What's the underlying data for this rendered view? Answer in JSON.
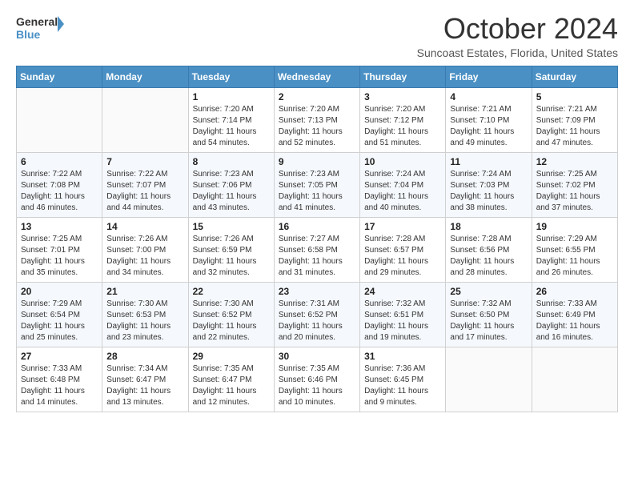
{
  "header": {
    "logo_line1": "General",
    "logo_line2": "Blue",
    "main_title": "October 2024",
    "subtitle": "Suncoast Estates, Florida, United States"
  },
  "calendar": {
    "days_of_week": [
      "Sunday",
      "Monday",
      "Tuesday",
      "Wednesday",
      "Thursday",
      "Friday",
      "Saturday"
    ],
    "weeks": [
      [
        {
          "day": "",
          "info": ""
        },
        {
          "day": "",
          "info": ""
        },
        {
          "day": "1",
          "info": "Sunrise: 7:20 AM\nSunset: 7:14 PM\nDaylight: 11 hours\nand 54 minutes."
        },
        {
          "day": "2",
          "info": "Sunrise: 7:20 AM\nSunset: 7:13 PM\nDaylight: 11 hours\nand 52 minutes."
        },
        {
          "day": "3",
          "info": "Sunrise: 7:20 AM\nSunset: 7:12 PM\nDaylight: 11 hours\nand 51 minutes."
        },
        {
          "day": "4",
          "info": "Sunrise: 7:21 AM\nSunset: 7:10 PM\nDaylight: 11 hours\nand 49 minutes."
        },
        {
          "day": "5",
          "info": "Sunrise: 7:21 AM\nSunset: 7:09 PM\nDaylight: 11 hours\nand 47 minutes."
        }
      ],
      [
        {
          "day": "6",
          "info": "Sunrise: 7:22 AM\nSunset: 7:08 PM\nDaylight: 11 hours\nand 46 minutes."
        },
        {
          "day": "7",
          "info": "Sunrise: 7:22 AM\nSunset: 7:07 PM\nDaylight: 11 hours\nand 44 minutes."
        },
        {
          "day": "8",
          "info": "Sunrise: 7:23 AM\nSunset: 7:06 PM\nDaylight: 11 hours\nand 43 minutes."
        },
        {
          "day": "9",
          "info": "Sunrise: 7:23 AM\nSunset: 7:05 PM\nDaylight: 11 hours\nand 41 minutes."
        },
        {
          "day": "10",
          "info": "Sunrise: 7:24 AM\nSunset: 7:04 PM\nDaylight: 11 hours\nand 40 minutes."
        },
        {
          "day": "11",
          "info": "Sunrise: 7:24 AM\nSunset: 7:03 PM\nDaylight: 11 hours\nand 38 minutes."
        },
        {
          "day": "12",
          "info": "Sunrise: 7:25 AM\nSunset: 7:02 PM\nDaylight: 11 hours\nand 37 minutes."
        }
      ],
      [
        {
          "day": "13",
          "info": "Sunrise: 7:25 AM\nSunset: 7:01 PM\nDaylight: 11 hours\nand 35 minutes."
        },
        {
          "day": "14",
          "info": "Sunrise: 7:26 AM\nSunset: 7:00 PM\nDaylight: 11 hours\nand 34 minutes."
        },
        {
          "day": "15",
          "info": "Sunrise: 7:26 AM\nSunset: 6:59 PM\nDaylight: 11 hours\nand 32 minutes."
        },
        {
          "day": "16",
          "info": "Sunrise: 7:27 AM\nSunset: 6:58 PM\nDaylight: 11 hours\nand 31 minutes."
        },
        {
          "day": "17",
          "info": "Sunrise: 7:28 AM\nSunset: 6:57 PM\nDaylight: 11 hours\nand 29 minutes."
        },
        {
          "day": "18",
          "info": "Sunrise: 7:28 AM\nSunset: 6:56 PM\nDaylight: 11 hours\nand 28 minutes."
        },
        {
          "day": "19",
          "info": "Sunrise: 7:29 AM\nSunset: 6:55 PM\nDaylight: 11 hours\nand 26 minutes."
        }
      ],
      [
        {
          "day": "20",
          "info": "Sunrise: 7:29 AM\nSunset: 6:54 PM\nDaylight: 11 hours\nand 25 minutes."
        },
        {
          "day": "21",
          "info": "Sunrise: 7:30 AM\nSunset: 6:53 PM\nDaylight: 11 hours\nand 23 minutes."
        },
        {
          "day": "22",
          "info": "Sunrise: 7:30 AM\nSunset: 6:52 PM\nDaylight: 11 hours\nand 22 minutes."
        },
        {
          "day": "23",
          "info": "Sunrise: 7:31 AM\nSunset: 6:52 PM\nDaylight: 11 hours\nand 20 minutes."
        },
        {
          "day": "24",
          "info": "Sunrise: 7:32 AM\nSunset: 6:51 PM\nDaylight: 11 hours\nand 19 minutes."
        },
        {
          "day": "25",
          "info": "Sunrise: 7:32 AM\nSunset: 6:50 PM\nDaylight: 11 hours\nand 17 minutes."
        },
        {
          "day": "26",
          "info": "Sunrise: 7:33 AM\nSunset: 6:49 PM\nDaylight: 11 hours\nand 16 minutes."
        }
      ],
      [
        {
          "day": "27",
          "info": "Sunrise: 7:33 AM\nSunset: 6:48 PM\nDaylight: 11 hours\nand 14 minutes."
        },
        {
          "day": "28",
          "info": "Sunrise: 7:34 AM\nSunset: 6:47 PM\nDaylight: 11 hours\nand 13 minutes."
        },
        {
          "day": "29",
          "info": "Sunrise: 7:35 AM\nSunset: 6:47 PM\nDaylight: 11 hours\nand 12 minutes."
        },
        {
          "day": "30",
          "info": "Sunrise: 7:35 AM\nSunset: 6:46 PM\nDaylight: 11 hours\nand 10 minutes."
        },
        {
          "day": "31",
          "info": "Sunrise: 7:36 AM\nSunset: 6:45 PM\nDaylight: 11 hours\nand 9 minutes."
        },
        {
          "day": "",
          "info": ""
        },
        {
          "day": "",
          "info": ""
        }
      ]
    ]
  }
}
